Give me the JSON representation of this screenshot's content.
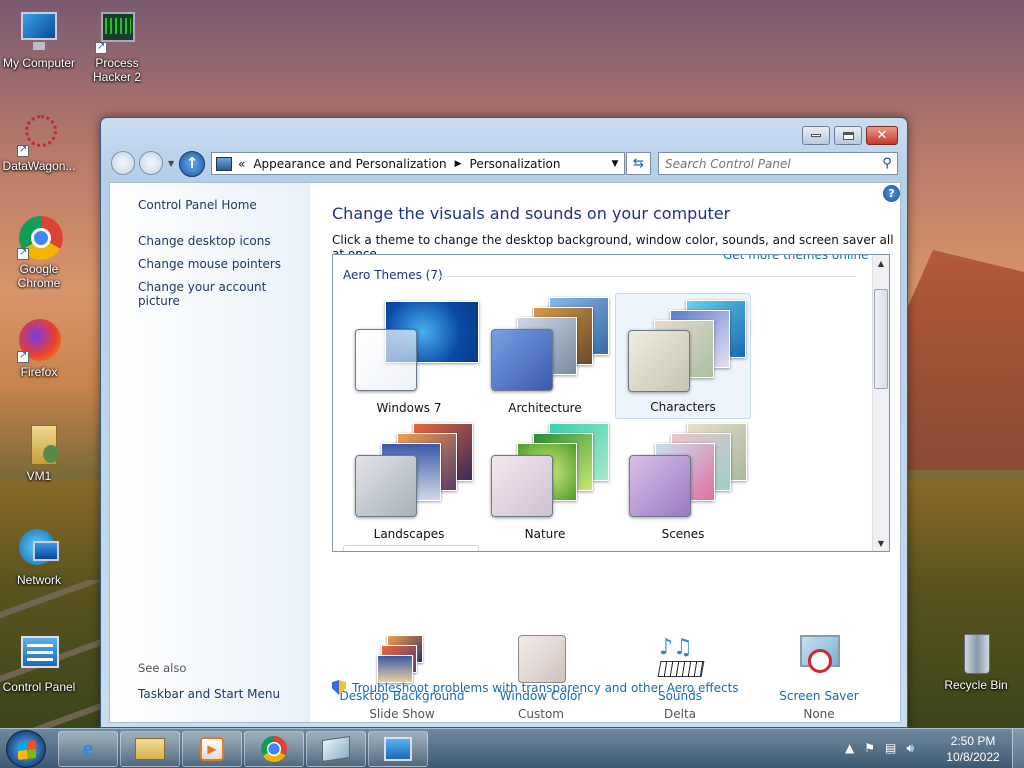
{
  "desktop": {
    "icons": [
      {
        "label": "My Computer"
      },
      {
        "label": "Process Hacker 2"
      },
      {
        "label": "DataWagon..."
      },
      {
        "label": "Google Chrome"
      },
      {
        "label": "Firefox"
      },
      {
        "label": "VM1"
      },
      {
        "label": "Network"
      },
      {
        "label": "Control Panel"
      },
      {
        "label": "Recycle Bin"
      }
    ]
  },
  "window": {
    "address": {
      "prefix": "«",
      "segments": [
        "Appearance and Personalization",
        "Personalization"
      ]
    },
    "search": {
      "placeholder": "Search Control Panel"
    },
    "help_label": "?",
    "close_label": "✕"
  },
  "sidebar": {
    "home": "Control Panel Home",
    "links": [
      "Change desktop icons",
      "Change mouse pointers",
      "Change your account picture"
    ],
    "see_also": "See also",
    "see_also_links": [
      "Taskbar and Start Menu"
    ]
  },
  "main": {
    "title": "Change the visuals and sounds on your computer",
    "description": "Click a theme to change the desktop background, window color, sounds, and screen saver all at once.",
    "get_more": "Get more themes online",
    "group_header": "Aero Themes (7)",
    "themes": [
      {
        "label": "Windows 7",
        "selected": false
      },
      {
        "label": "Architecture",
        "selected": false
      },
      {
        "label": "Characters",
        "selected": true
      },
      {
        "label": "Landscapes",
        "selected": false
      },
      {
        "label": "Nature",
        "selected": false
      },
      {
        "label": "Scenes",
        "selected": false
      }
    ],
    "bottom": [
      {
        "label": "Desktop Background",
        "sub": "Slide Show"
      },
      {
        "label": "Window Color",
        "sub": "Custom"
      },
      {
        "label": "Sounds",
        "sub": "Delta"
      },
      {
        "label": "Screen Saver",
        "sub": "None"
      }
    ],
    "troubleshoot": "Troubleshoot problems with transparency and other Aero effects"
  },
  "taskbar": {
    "time": "2:50 PM",
    "date": "10/8/2022"
  }
}
